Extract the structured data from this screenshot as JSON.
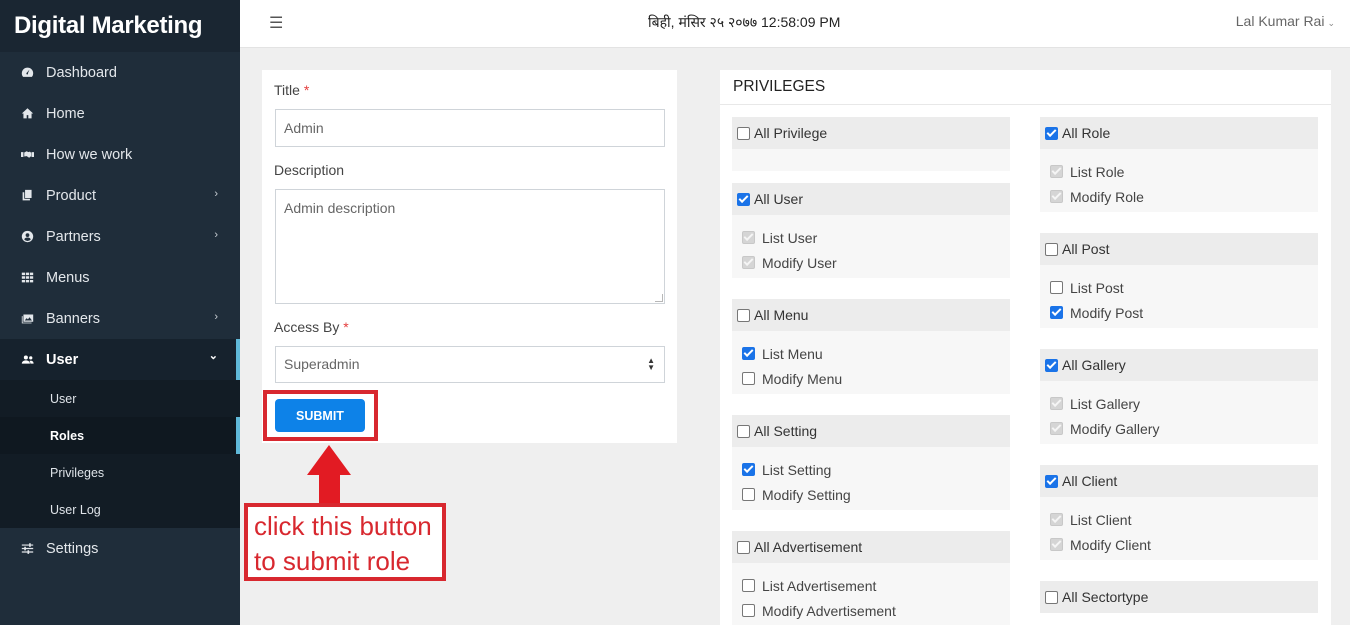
{
  "app": {
    "brand": "Digital Marketing"
  },
  "sidebar": {
    "items": [
      {
        "label": "Dashboard",
        "icon": "dashboard-icon"
      },
      {
        "label": "Home",
        "icon": "home-icon"
      },
      {
        "label": "How we work",
        "icon": "handshake-icon"
      },
      {
        "label": "Product",
        "icon": "copy-icon",
        "chevron": "›"
      },
      {
        "label": "Partners",
        "icon": "user-circle-icon",
        "chevron": "›"
      },
      {
        "label": "Menus",
        "icon": "grid-icon"
      },
      {
        "label": "Banners",
        "icon": "images-icon",
        "chevron": "›"
      },
      {
        "label": "User",
        "icon": "users-icon",
        "chevron": "⌄"
      },
      {
        "label": "Settings",
        "icon": "sliders-icon"
      }
    ],
    "submenu": [
      {
        "label": "User"
      },
      {
        "label": "Roles"
      },
      {
        "label": "Privileges"
      },
      {
        "label": "User Log"
      }
    ]
  },
  "topbar": {
    "menu_icon": "☰",
    "datetime": "बिही, मंसिर २५ २०७७ 12:58:09 PM",
    "user": "Lal Kumar Rai",
    "user_caret": "⌄"
  },
  "form": {
    "title_label": "Title",
    "title_value": "Admin",
    "description_label": "Description",
    "description_value": "Admin description",
    "access_label": "Access By",
    "access_value": "Superadmin",
    "required_mark": "*",
    "submit_label": "SUBMIT"
  },
  "annotation": {
    "line1": "click this button",
    "line2": "to submit role",
    "color": "#d8282f"
  },
  "privileges": {
    "title": "PRIVILEGES",
    "groups": [
      {
        "name": "All Privilege",
        "checked": false,
        "items": []
      },
      {
        "name": "All User",
        "checked": true,
        "items": [
          {
            "label": "List User",
            "state": "disabled-checked"
          },
          {
            "label": "Modify User",
            "state": "disabled-checked"
          }
        ]
      },
      {
        "name": "All Menu",
        "checked": false,
        "items": [
          {
            "label": "List Menu",
            "state": "checked"
          },
          {
            "label": "Modify Menu",
            "state": "unchecked"
          }
        ]
      },
      {
        "name": "All Setting",
        "checked": false,
        "items": [
          {
            "label": "List Setting",
            "state": "checked"
          },
          {
            "label": "Modify Setting",
            "state": "unchecked"
          }
        ]
      },
      {
        "name": "All Advertisement",
        "checked": false,
        "items": [
          {
            "label": "List Advertisement",
            "state": "unchecked"
          },
          {
            "label": "Modify Advertisement",
            "state": "unchecked"
          }
        ]
      },
      {
        "name": "All Role",
        "checked": true,
        "items": [
          {
            "label": "List Role",
            "state": "disabled-checked"
          },
          {
            "label": "Modify Role",
            "state": "disabled-checked"
          }
        ]
      },
      {
        "name": "All Post",
        "checked": false,
        "items": [
          {
            "label": "List Post",
            "state": "unchecked"
          },
          {
            "label": "Modify Post",
            "state": "checked"
          }
        ]
      },
      {
        "name": "All Gallery",
        "checked": true,
        "items": [
          {
            "label": "List Gallery",
            "state": "disabled-checked"
          },
          {
            "label": "Modify Gallery",
            "state": "disabled-checked"
          }
        ]
      },
      {
        "name": "All Client",
        "checked": true,
        "items": [
          {
            "label": "List Client",
            "state": "disabled-checked"
          },
          {
            "label": "Modify Client",
            "state": "disabled-checked"
          }
        ]
      },
      {
        "name": "All Sectortype",
        "checked": false,
        "items": []
      }
    ]
  },
  "colors": {
    "sidebar_bg": "#1f2d3a",
    "accent": "#5fb8d8",
    "submit_button": "#0d82e8",
    "checkbox_checked": "#1a73e8"
  }
}
